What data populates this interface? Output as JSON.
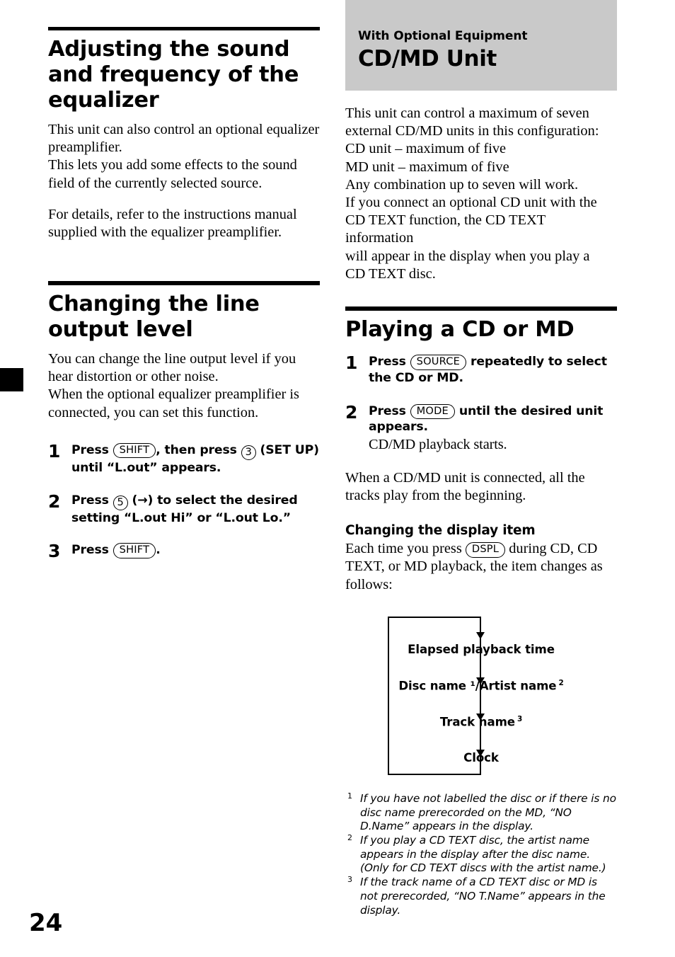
{
  "page": {
    "number": "24"
  },
  "left_column": {
    "section1": {
      "title": "Adjusting the sound and frequency of the equalizer",
      "paragraph1": "This unit can also control an optional equalizer preamplifier.",
      "paragraph2": "This lets you add some effects to the sound field of the currently selected source.",
      "paragraph3": "For details, refer to the instructions manual supplied with the equalizer preamplifier."
    },
    "section2": {
      "title": "Changing the line output level",
      "paragraph1": "You can change the line output level if you hear distortion or other noise.",
      "paragraph2": "When the optional equalizer preamplifier is connected, you can set this function.",
      "steps": [
        {
          "number": "1",
          "before_key": "Press ",
          "key1": "SHIFT",
          "mid": ", then press ",
          "key2": "3",
          "after": " (SET UP) until “L.out” appears."
        },
        {
          "number": "2",
          "before_key": "Press ",
          "key1": "5",
          "after": " (→) to select the desired setting “L.out Hi” or “L.out Lo.”"
        },
        {
          "number": "3",
          "before_key": "Press ",
          "key1": "SHIFT",
          "after": "."
        }
      ]
    }
  },
  "right_column": {
    "banner": {
      "kicker": "With Optional Equipment",
      "title": "CD/MD Unit",
      "background_color": "#c9c9c9"
    },
    "intro_lines": [
      "This unit can control a maximum of seven",
      "external CD/MD units in this configuration:",
      "CD unit – maximum of five",
      "MD unit – maximum of five",
      "Any combination up to seven will work.",
      "If you connect an optional CD unit with the",
      "CD TEXT function, the CD TEXT information",
      "will appear in the display when you play a",
      "CD TEXT disc."
    ],
    "section": {
      "title": "Playing a CD or MD",
      "steps": [
        {
          "number": "1",
          "before_key": "Press ",
          "key1": "SOURCE",
          "after": " repeatedly to select the CD or MD."
        },
        {
          "number": "2",
          "before_key": "Press ",
          "key1": "MODE",
          "after": " until the desired unit appears.",
          "note": "CD/MD playback starts."
        }
      ],
      "closing_paragraph": "When a CD/MD unit is connected, all the tracks play from the beginning."
    },
    "display_item": {
      "title": "Changing the display item",
      "intro_before": "Each time you press ",
      "intro_key": "DSPL",
      "intro_after": " during CD, CD TEXT, or MD playback, the item changes as follows:",
      "flow": [
        {
          "label": "Elapsed playback time",
          "sup": ""
        },
        {
          "label": "Disc name ¹/Artist name",
          "sup": "2"
        },
        {
          "label": "Track name",
          "sup": "3"
        },
        {
          "label": "Clock",
          "sup": ""
        }
      ],
      "footnotes": [
        {
          "mark": "1",
          "text": "If you have not labelled the disc or if there is no disc name  prerecorded on the MD, “NO D.Name” appears in the display."
        },
        {
          "mark": "2",
          "text": "If you play a CD TEXT disc, the artist name appears in the display after the disc name. (Only for CD TEXT discs with the artist name.)"
        },
        {
          "mark": "3",
          "text": "If the track name of a CD TEXT disc or MD is not prerecorded, “NO T.Name” appears in the display."
        }
      ]
    }
  }
}
